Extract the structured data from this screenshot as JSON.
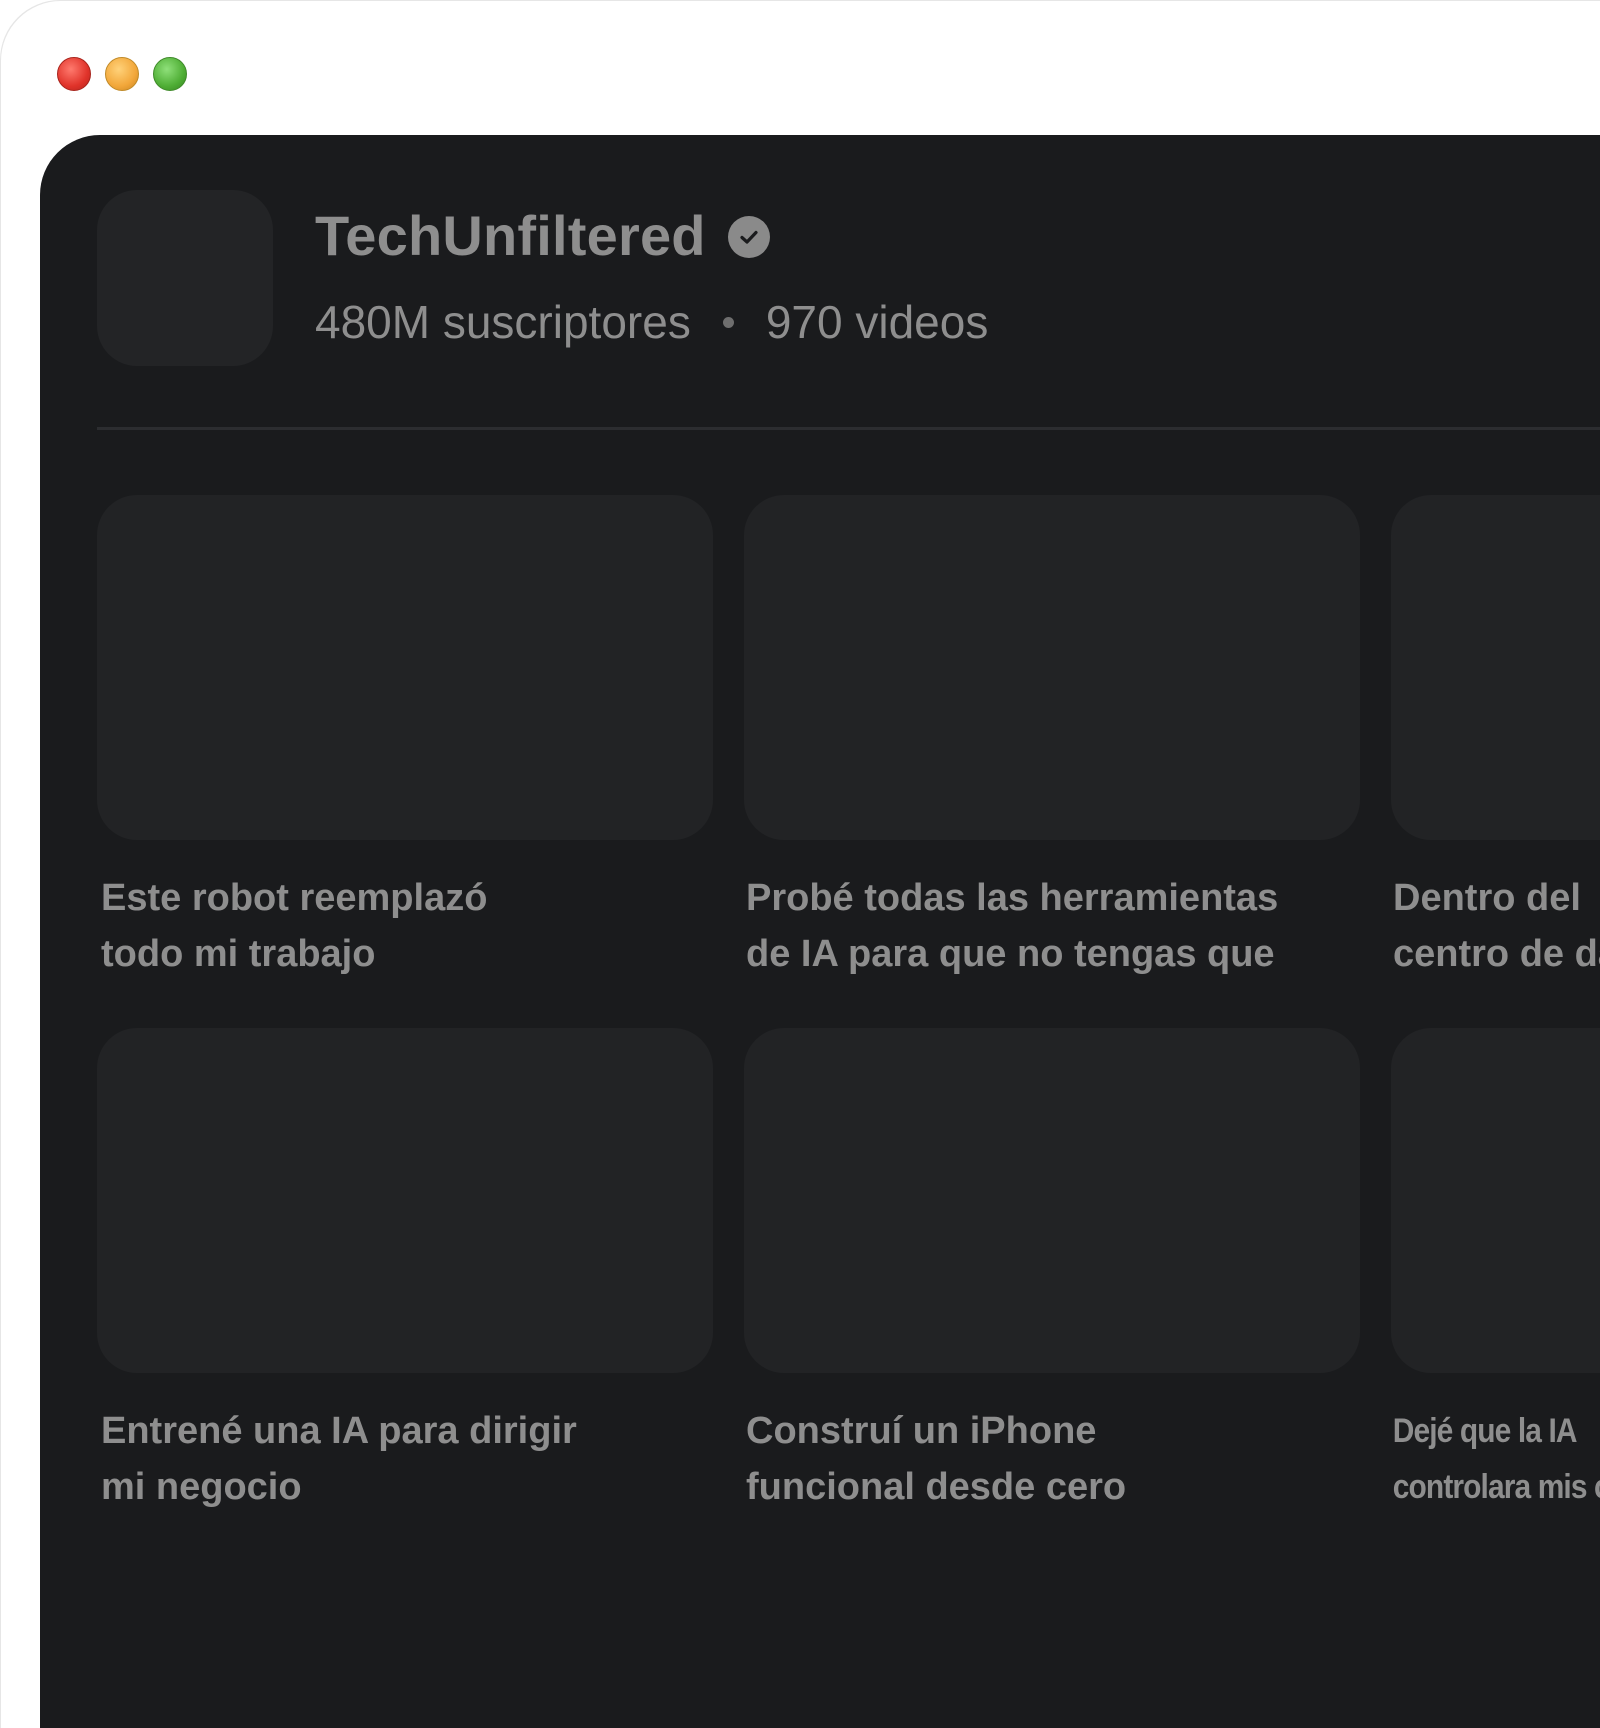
{
  "channel": {
    "name": "TechUnfiltered",
    "subscribers": "480M suscriptores",
    "video_count": "970 videos"
  },
  "videos": [
    {
      "title": "Este robot reemplazó\ntodo mi trabajo"
    },
    {
      "title": "Probé todas las herramientas\nde IA para que no tengas que"
    },
    {
      "title": "Dentro del\ncentro de da"
    },
    {
      "title": "Entrené una IA para dirigir\nmi negocio"
    },
    {
      "title": "Construí un iPhone\nfuncional desde cero"
    },
    {
      "title": "Dejé que la IA\ncontrolara mis c"
    }
  ],
  "colors": {
    "background": "#1a1b1d",
    "thumbnail": "#222325",
    "text": "#8e8e8e"
  }
}
